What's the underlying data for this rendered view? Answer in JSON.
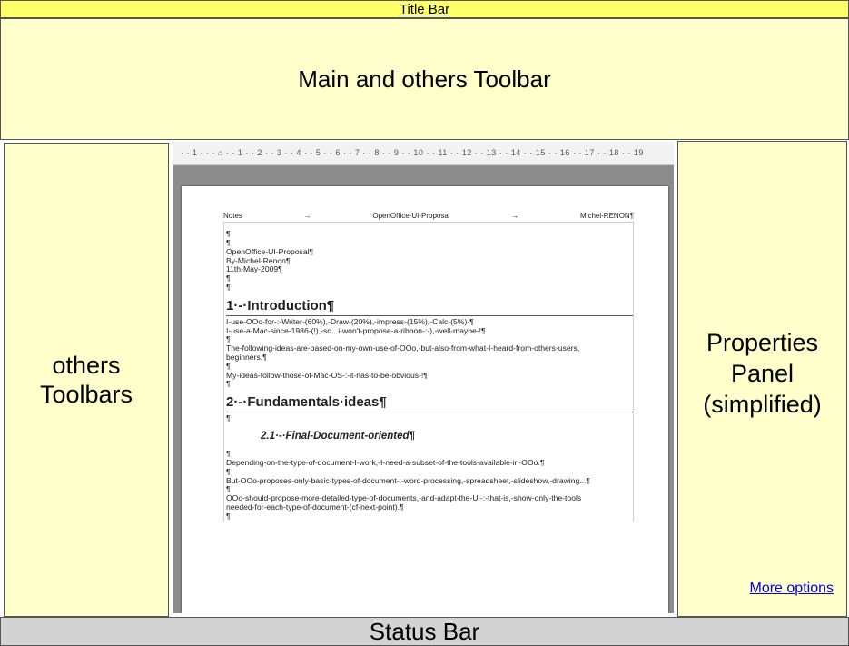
{
  "title_bar": {
    "label": "Title Bar"
  },
  "main_toolbar": {
    "label": "Main and others Toolbar"
  },
  "left_toolbars": {
    "line1": "others",
    "line2": "Toolbars"
  },
  "properties_panel": {
    "line1": "Properties",
    "line2": "Panel",
    "line3": "(simplified)",
    "more_options": "More options"
  },
  "status_bar": {
    "label": "Status Bar"
  },
  "ruler": {
    "ticks": "· · 1 · · · ⌂ · · 1 · · 2 · · 3 · · 4 · · 5 · · 6 · · 7 · · 8 · · 9 · · 10 · · 11 · · 12 · · 13 · · 14 · · 15 · · 16 · · 17 · · 18 · · 19"
  },
  "document": {
    "header_left": "Notes",
    "header_arrow1": "→",
    "header_center": "OpenOffice-UI-Proposal",
    "header_arrow2": "→",
    "header_right": "Michel-RENON¶",
    "lines_intro": [
      "¶",
      "¶",
      "OpenOffice-UI-Proposal¶",
      "By-Michel-Renon¶",
      "11th-May-2009¶",
      "¶",
      "¶"
    ],
    "heading1": "1·-·Introduction¶",
    "lines_section1": [
      "I-use-OOo-for-:-Writer-(60%),-Draw-(20%),-impress-(15%),-Calc-(5%)-¶",
      "I-use-a-Mac-since-1986-(!),-so...i-won't-propose-a-ribbon-:-),-well-maybe-!¶",
      "¶",
      "The-following-ideas-are-based-on-my-own-use-of-OOo,-but-also-from-what-I-heard-from-others-users,",
      "beginners.¶",
      "¶",
      "My-ideas-follow-those-of-Mac-OS-:-it-has-to-be-obvious-!¶",
      "¶"
    ],
    "heading2": "2·-·Fundamentals·ideas¶",
    "lines_section2": [
      "¶"
    ],
    "heading3": "2.1·-·Final-Document-oriented¶",
    "lines_section3": [
      "¶",
      "Depending-on-the-type-of-document-I-work,-I-need-a-subset-of-the-tools-available-in-OOo.¶",
      "¶",
      "But-OOo-proposes-only-basic-types-of-document-:-word-processing,-spreadsheet,-slideshow,-drawing...¶",
      "¶",
      "OOo-should-propose-more-detailed-type-of-documents,-and-adapt-the-UI-:-that-is,-show-only-the-tools",
      "needed-for-each-type-of-document-(cf-next-point).¶",
      "¶"
    ]
  }
}
